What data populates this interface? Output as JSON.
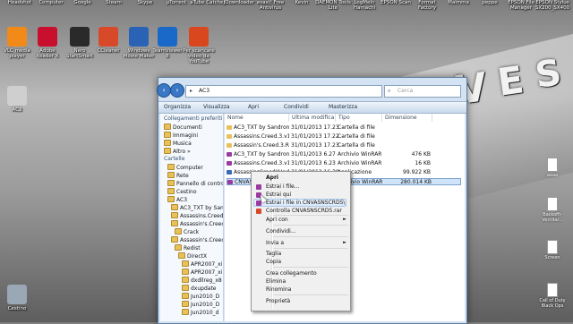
{
  "desktop": {
    "top_row_labels": [
      "Headshot",
      "Computer",
      "Google",
      "Steam",
      "Skype",
      "µTorrent",
      "aTube Catcher",
      "JDownloader",
      "avast! Free Antivirus",
      "Kevin",
      "DAEMON Tools Lite",
      "LogMeIn Hamachi",
      "EPSON Scan",
      "Format Factory",
      "Maimma",
      "peppe",
      "EPSON File Manager",
      "EPSON Stylus SX200_SX400"
    ],
    "icons": [
      {
        "label": "VLC media player",
        "color": "#f28a1a"
      },
      {
        "label": "Adobe Reader X",
        "color": "#c8102e"
      },
      {
        "label": "Nero StartSmart",
        "color": "#2a2a2a"
      },
      {
        "label": "CCleaner",
        "color": "#d8492a"
      },
      {
        "label": "Windows Movie Maker",
        "color": "#2a62b6"
      },
      {
        "label": "TeamViewer 8",
        "color": "#1a69c9"
      },
      {
        "label": "Per scaricare video da YouTube",
        "color": "#d9471f"
      },
      {
        "label": "AC3",
        "color": "#cfcfcf"
      },
      {
        "label": "Cestino",
        "color": "#9aa7b5"
      }
    ],
    "right_icons": [
      {
        "label": "aaaa"
      },
      {
        "label": "Backoffi- Ventilar..."
      },
      {
        "label": "Screen"
      },
      {
        "label": "Call of Duty Black Ops"
      }
    ],
    "wallpaper_text": "REVOLVES"
  },
  "explorer": {
    "address": "AC3",
    "search_placeholder": "Cerca",
    "toolbar": {
      "organize": "Organizza",
      "view": "Visualizza",
      "open": "Apri",
      "share": "Condividi",
      "burn": "Masterizza"
    },
    "left_pane": [
      {
        "label": "Collegamenti preferiti",
        "indent": 0,
        "type": "header"
      },
      {
        "label": "Documenti",
        "indent": 0,
        "type": "item"
      },
      {
        "label": "Immagini",
        "indent": 0,
        "type": "item"
      },
      {
        "label": "Musica",
        "indent": 0,
        "type": "item"
      },
      {
        "label": "Altro »",
        "indent": 0,
        "type": "item"
      },
      {
        "label": "Cartelle",
        "indent": 0,
        "type": "header"
      },
      {
        "label": "Computer",
        "indent": 1,
        "type": "item"
      },
      {
        "label": "Rete",
        "indent": 1,
        "type": "item"
      },
      {
        "label": "Pannello di contro",
        "indent": 1,
        "type": "item"
      },
      {
        "label": "Cestino",
        "indent": 1,
        "type": "item"
      },
      {
        "label": "AC3",
        "indent": 1,
        "type": "item"
      },
      {
        "label": "AC3_TXT by San",
        "indent": 2,
        "type": "item"
      },
      {
        "label": "Assassins.Creed.",
        "indent": 2,
        "type": "item"
      },
      {
        "label": "Assassin's.Creed.",
        "indent": 2,
        "type": "item"
      },
      {
        "label": "Crack",
        "indent": 3,
        "type": "item"
      },
      {
        "label": "Assassin's.Creed.",
        "indent": 2,
        "type": "item"
      },
      {
        "label": "Redist",
        "indent": 3,
        "type": "item"
      },
      {
        "label": "DirectX",
        "indent": 4,
        "type": "item"
      },
      {
        "label": "APR2007_xi",
        "indent": 5,
        "type": "item"
      },
      {
        "label": "APR2007_xi",
        "indent": 5,
        "type": "item"
      },
      {
        "label": "dxdllreg_x8",
        "indent": 5,
        "type": "item"
      },
      {
        "label": "dxupdate",
        "indent": 5,
        "type": "item"
      },
      {
        "label": "Jun2010_D",
        "indent": 5,
        "type": "item"
      },
      {
        "label": "Jun2010_D",
        "indent": 5,
        "type": "item"
      },
      {
        "label": "Jun2010_d",
        "indent": 5,
        "type": "item"
      }
    ],
    "columns": [
      "Nome",
      "Ultima modifica",
      "Tipo",
      "Dimensione"
    ],
    "files": [
      {
        "name": "AC3_TXT by Sandrone",
        "date": "31/01/2013 17.23",
        "type": "Cartella di file",
        "size": "",
        "icon": "#e9c15a"
      },
      {
        "name": "Assassins.Creed.3.v1.0...",
        "date": "31/01/2013 17.22",
        "type": "Cartella di file",
        "size": "",
        "icon": "#e9c15a"
      },
      {
        "name": "Assassin's.Creed.3.RiP...",
        "date": "31/01/2013 17.23",
        "type": "Cartella di file",
        "size": "",
        "icon": "#e9c15a"
      },
      {
        "name": "AC3_TXT by Sandrone",
        "date": "31/01/2013 6.27",
        "type": "Archivio WinRAR",
        "size": "476 KB",
        "icon": "#9b3aa3"
      },
      {
        "name": "Assassins.Creed.3.v1.0...",
        "date": "31/01/2013 6.23",
        "type": "Archivio WinRAR",
        "size": "16 KB",
        "icon": "#9b3aa3"
      },
      {
        "name": "AssassinsCreedIIUpdat...",
        "date": "31/01/2013 16.30",
        "type": "Applicazione",
        "size": "99.922 KB",
        "icon": "#3a6bb8"
      },
      {
        "name": "CNVASNSCRD5...",
        "date": "31/01/2013 13.22",
        "type": "Archivio WinRAR",
        "size": "280.014 KB",
        "icon": "#9b3aa3",
        "selected": true
      }
    ]
  },
  "context_menu": {
    "items": [
      {
        "label": "Apri",
        "bold": true,
        "icon": "",
        "arrow": false
      },
      {
        "label": "Estrai i file...",
        "icon": "#9b3aa3",
        "arrow": false
      },
      {
        "label": "Estrai qui",
        "icon": "#9b3aa3",
        "arrow": false
      },
      {
        "label": "Estrai i file in CNVASNSCRD5\\",
        "icon": "#9b3aa3",
        "arrow": false,
        "highlight": true
      },
      {
        "label": "Controlla CNVASNSCRD5.rar",
        "icon": "#d8492a",
        "arrow": false
      },
      {
        "label": "Apri con",
        "icon": "",
        "arrow": true
      },
      {
        "label": "Condividi...",
        "icon": "",
        "arrow": false
      },
      {
        "label": "Invia a",
        "icon": "",
        "arrow": true
      },
      {
        "label": "Taglia",
        "icon": "",
        "arrow": false
      },
      {
        "label": "Copia",
        "icon": "",
        "arrow": false
      },
      {
        "label": "Crea collegamento",
        "icon": "",
        "arrow": false
      },
      {
        "label": "Elimina",
        "icon": "",
        "arrow": false
      },
      {
        "label": "Rinomina",
        "icon": "",
        "arrow": false
      },
      {
        "label": "Proprietà",
        "icon": "",
        "arrow": false
      }
    ],
    "arrow_glyph": "►"
  }
}
